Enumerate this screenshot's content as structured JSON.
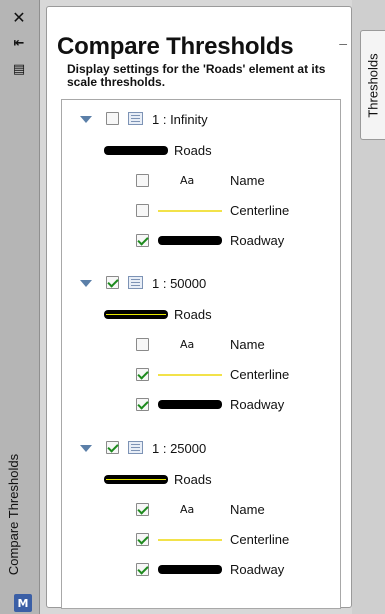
{
  "sidebar": {
    "close_glyph": "✕",
    "pin_glyph": "⇤",
    "menu_glyph": "▤",
    "title": "Compare Thresholds",
    "app_badge": "M"
  },
  "panel": {
    "title": "Compare Thresholds",
    "description": "Display settings for the 'Roads' element at its scale thresholds.",
    "collapse_glyph": "–"
  },
  "tab": {
    "label": "Thresholds"
  },
  "thresholds": [
    {
      "scale": "1 : Infinity",
      "checked": false,
      "roads_label": "Roads",
      "items": [
        {
          "label": "Name",
          "checked": false
        },
        {
          "label": "Centerline",
          "checked": false
        },
        {
          "label": "Roadway",
          "checked": true
        }
      ]
    },
    {
      "scale": "1 : 50000",
      "checked": true,
      "roads_label": "Roads",
      "items": [
        {
          "label": "Name",
          "checked": false
        },
        {
          "label": "Centerline",
          "checked": true
        },
        {
          "label": "Roadway",
          "checked": true
        }
      ]
    },
    {
      "scale": "1 : 25000",
      "checked": true,
      "roads_label": "Roads",
      "items": [
        {
          "label": "Name",
          "checked": true
        },
        {
          "label": "Centerline",
          "checked": true
        },
        {
          "label": "Roadway",
          "checked": true
        }
      ]
    }
  ],
  "icons": {
    "aa_glyph": "Aa",
    "expand": "expand-triangle-icon",
    "scale": "scale-table-icon"
  },
  "colors": {
    "checkmark": "#1d8a1d",
    "centerline": "#f2e24a",
    "roadway": "#000000",
    "triangle": "#5b7fa8"
  }
}
